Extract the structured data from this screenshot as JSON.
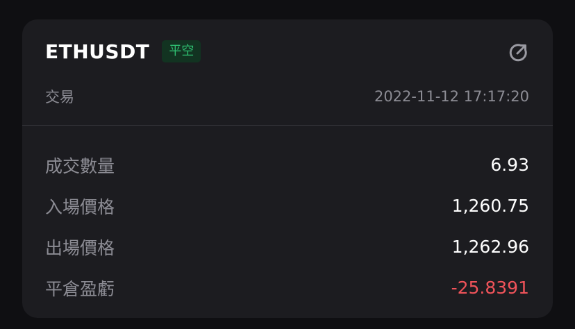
{
  "trade": {
    "symbol": "ETHUSDT",
    "side_badge": "平空",
    "type_label": "交易",
    "timestamp": "2022-11-12 17:17:20",
    "share_icon": "share-icon"
  },
  "details": [
    {
      "label": "成交數量",
      "value": "6.93"
    },
    {
      "label": "入場價格",
      "value": "1,260.75"
    },
    {
      "label": "出場價格",
      "value": "1,262.96"
    },
    {
      "label": "平倉盈虧",
      "value": "-25.8391"
    }
  ],
  "colors": {
    "background": "#0f0f12",
    "card": "#1c1c20",
    "badge_bg": "#123321",
    "badge_text": "#2fbf71",
    "negative": "#f0535a",
    "muted": "#8c8c94"
  }
}
